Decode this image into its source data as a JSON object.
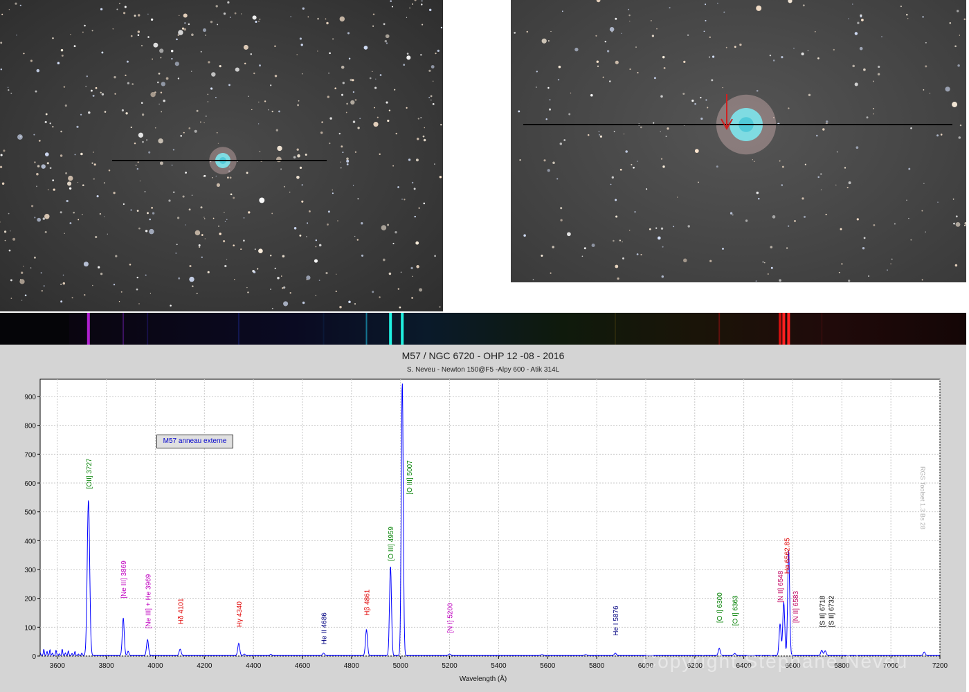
{
  "images": {
    "left_caption": "",
    "right_caption": ""
  },
  "spectrum_strip": {
    "lines": [
      {
        "wl": 3727,
        "color": "#b020d0",
        "strength": 1.0
      },
      {
        "wl": 3869,
        "color": "#7020b0",
        "strength": 0.5
      },
      {
        "wl": 3968,
        "color": "#3020a0",
        "strength": 0.35
      },
      {
        "wl": 4340,
        "color": "#2030a0",
        "strength": 0.4
      },
      {
        "wl": 4686,
        "color": "#104080",
        "strength": 0.2
      },
      {
        "wl": 4861,
        "color": "#1aa0c0",
        "strength": 0.7
      },
      {
        "wl": 4959,
        "color": "#20f0e0",
        "strength": 1.0
      },
      {
        "wl": 5007,
        "color": "#20f0e0",
        "strength": 1.0
      },
      {
        "wl": 5876,
        "color": "#4a4010",
        "strength": 0.4
      },
      {
        "wl": 6300,
        "color": "#901010",
        "strength": 0.6
      },
      {
        "wl": 6548,
        "color": "#e01010",
        "strength": 0.9
      },
      {
        "wl": 6563,
        "color": "#ff2020",
        "strength": 1.0
      },
      {
        "wl": 6583,
        "color": "#ff2020",
        "strength": 1.0
      },
      {
        "wl": 6718,
        "color": "#501010",
        "strength": 0.4
      }
    ]
  },
  "chart_data": {
    "type": "line",
    "title": "M57 / NGC 6720 - OHP 12 -08 - 2016",
    "subtitle": "S. Neveu - Newton 150@F5 -Alpy 600 - Atik 314L",
    "xlabel": "Wavelength (Å)",
    "ylabel": "",
    "xlim": [
      3530,
      7200
    ],
    "ylim": [
      0,
      960
    ],
    "grid": true,
    "xticks": [
      3600,
      3800,
      4000,
      4200,
      4400,
      4600,
      4800,
      5000,
      5200,
      5400,
      5600,
      5800,
      6000,
      6200,
      6400,
      6600,
      6800,
      7000,
      7200
    ],
    "yticks": [
      0,
      100,
      200,
      300,
      400,
      500,
      600,
      700,
      800,
      900
    ],
    "legend": "top-left",
    "series": [
      {
        "name": "M57 anneau externe",
        "color": "#0000ff",
        "peaks": [
          {
            "x": 3727,
            "y": 540,
            "w": 5
          },
          {
            "x": 3869,
            "y": 130,
            "w": 4
          },
          {
            "x": 3889,
            "y": 15,
            "w": 3
          },
          {
            "x": 3968,
            "y": 55,
            "w": 4
          },
          {
            "x": 4101,
            "y": 22,
            "w": 4
          },
          {
            "x": 4340,
            "y": 42,
            "w": 4
          },
          {
            "x": 4363,
            "y": 5,
            "w": 3
          },
          {
            "x": 4471,
            "y": 4,
            "w": 3
          },
          {
            "x": 4686,
            "y": 8,
            "w": 4
          },
          {
            "x": 4861,
            "y": 90,
            "w": 4
          },
          {
            "x": 4959,
            "y": 310,
            "w": 4
          },
          {
            "x": 5007,
            "y": 950,
            "w": 4
          },
          {
            "x": 5200,
            "y": 5,
            "w": 4
          },
          {
            "x": 5577,
            "y": 3,
            "w": 4
          },
          {
            "x": 5755,
            "y": 3,
            "w": 4
          },
          {
            "x": 5876,
            "y": 8,
            "w": 4
          },
          {
            "x": 6300,
            "y": 25,
            "w": 4
          },
          {
            "x": 6363,
            "y": 7,
            "w": 4
          },
          {
            "x": 6548,
            "y": 110,
            "w": 4
          },
          {
            "x": 6563,
            "y": 185,
            "w": 4
          },
          {
            "x": 6583,
            "y": 365,
            "w": 4
          },
          {
            "x": 6718,
            "y": 18,
            "w": 4
          },
          {
            "x": 6732,
            "y": 16,
            "w": 4
          },
          {
            "x": 7136,
            "y": 12,
            "w": 4
          }
        ],
        "noise": [
          [
            3530,
            10
          ],
          [
            3545,
            22
          ],
          [
            3558,
            14
          ],
          [
            3570,
            20
          ],
          [
            3580,
            8
          ],
          [
            3595,
            18
          ],
          [
            3608,
            6
          ],
          [
            3620,
            22
          ],
          [
            3633,
            9
          ],
          [
            3645,
            16
          ],
          [
            3660,
            7
          ],
          [
            3672,
            14
          ],
          [
            3686,
            5
          ],
          [
            3700,
            8
          ]
        ]
      }
    ],
    "annotations": [
      {
        "text": "[OII] 3727",
        "x": 3727,
        "y": 580,
        "color": "#008000"
      },
      {
        "text": "[Ne III] 3869",
        "x": 3869,
        "y": 200,
        "color": "#c000c0"
      },
      {
        "text": "[Ne III] + He 3969",
        "x": 3969,
        "y": 95,
        "color": "#c000c0"
      },
      {
        "text": "Hδ 4101",
        "x": 4101,
        "y": 110,
        "color": "#e00000"
      },
      {
        "text": "Hγ 4340",
        "x": 4340,
        "y": 100,
        "color": "#e00000"
      },
      {
        "text": "He II 4686",
        "x": 4686,
        "y": 40,
        "color": "#000080"
      },
      {
        "text": "Hβ 4861",
        "x": 4861,
        "y": 140,
        "color": "#e00000"
      },
      {
        "text": "[O III] 4959",
        "x": 4959,
        "y": 330,
        "color": "#008000"
      },
      {
        "text": "[O III] 5007",
        "x": 5035,
        "y": 560,
        "color": "#008000"
      },
      {
        "text": "[N I] 5200",
        "x": 5200,
        "y": 80,
        "color": "#c000c0"
      },
      {
        "text": "He I 5876",
        "x": 5876,
        "y": 70,
        "color": "#000080"
      },
      {
        "text": "[O I] 6300",
        "x": 6300,
        "y": 115,
        "color": "#008000"
      },
      {
        "text": "[O I] 6363",
        "x": 6363,
        "y": 105,
        "color": "#008000"
      },
      {
        "text": "[N II] 6548",
        "x": 6548,
        "y": 185,
        "color": "#c00060"
      },
      {
        "text": "Hα 6562.85",
        "x": 6575,
        "y": 285,
        "color": "#e00000"
      },
      {
        "text": "[N II] 6583",
        "x": 6610,
        "y": 115,
        "color": "#c00060"
      },
      {
        "text": "[S II] 6718",
        "x": 6718,
        "y": 100,
        "color": "#000000"
      },
      {
        "text": "[S II] 6732",
        "x": 6755,
        "y": 100,
        "color": "#000000"
      }
    ],
    "side_label": "RGS Toolset 1.3 Bs 28",
    "watermark": "Copyright Stéphane  Neveu"
  }
}
